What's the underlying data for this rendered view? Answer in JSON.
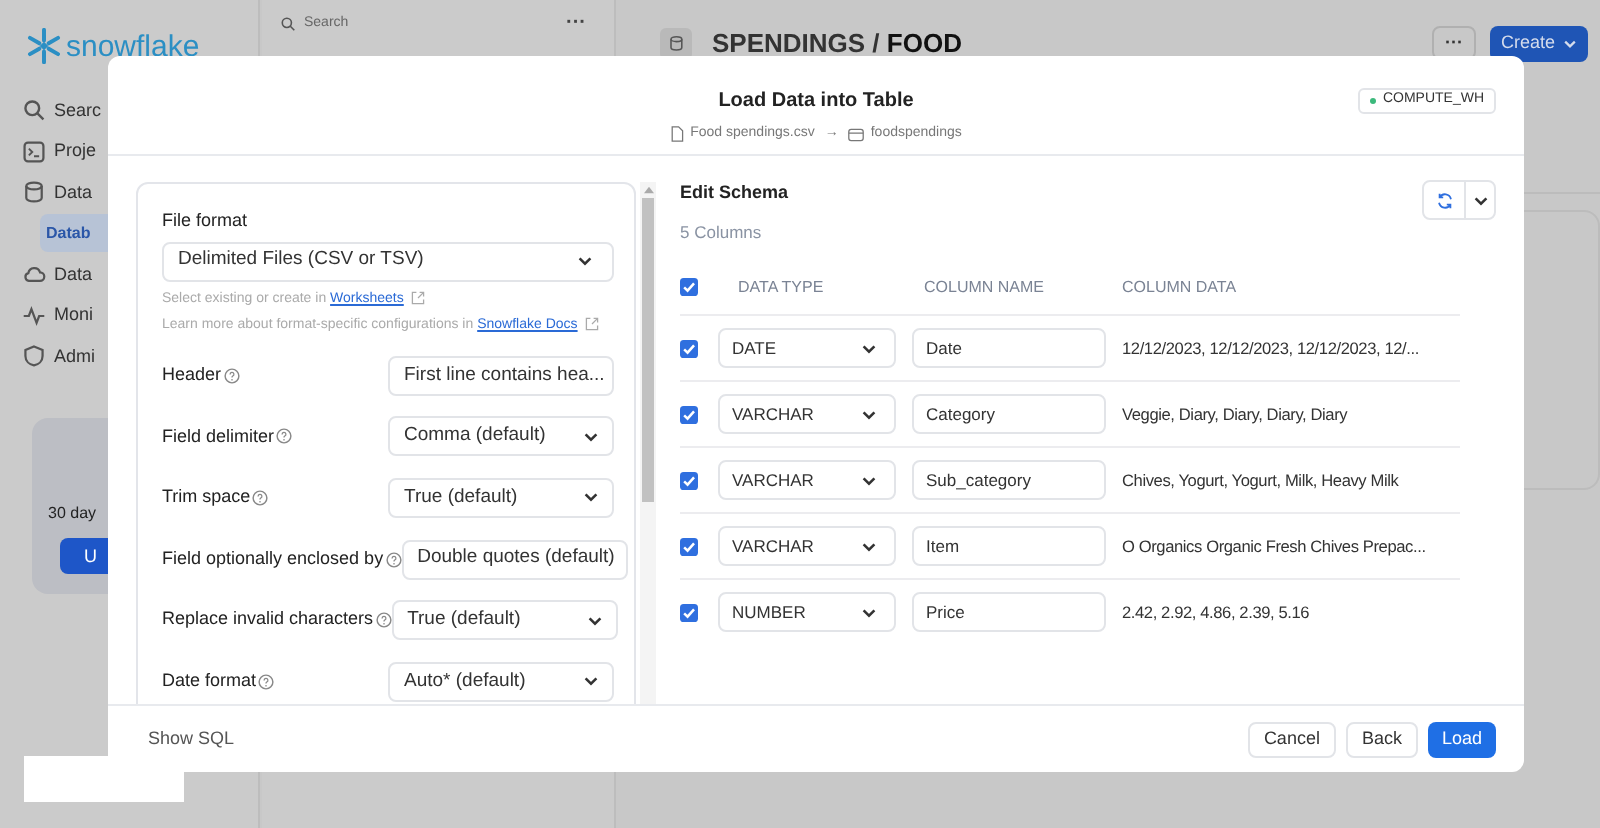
{
  "sidebar": {
    "logo": "snowflake",
    "items": [
      {
        "label": "Searc",
        "selected": false
      },
      {
        "label": "Proje",
        "selected": false
      },
      {
        "label": "Data",
        "selected": false
      },
      {
        "label": "Datab",
        "selected": true
      },
      {
        "label": "Data",
        "selected": false
      },
      {
        "label": "Moni",
        "selected": false
      },
      {
        "label": "Admi",
        "selected": false
      }
    ],
    "trial": {
      "text": "30 day",
      "button": "U"
    }
  },
  "browser": {
    "search_placeholder": "Search",
    "more": "···"
  },
  "page_header": {
    "title": "SPENDINGS / ",
    "title_bold": "FOOD",
    "more": "···",
    "create": "Create"
  },
  "dialog": {
    "title": "Load Data into Table",
    "source_file": "Food spendings.csv",
    "arrow": "→",
    "target_table": "foodspendings",
    "warehouse": "COMPUTE_WH",
    "file_format": {
      "label": "File format",
      "value": "Delimited Files (CSV or TSV)",
      "hint_text": "Select existing or create in ",
      "hint_link": "Worksheets",
      "docs_text": "Learn more about format-specific configurations in ",
      "docs_link": "Snowflake Docs"
    },
    "options": [
      {
        "label": "Header",
        "value": "First line contains hea..."
      },
      {
        "label": "Field delimiter",
        "value": "Comma (default)"
      },
      {
        "label": "Trim space",
        "value": "True (default)"
      },
      {
        "label": "Field optionally enclosed by",
        "value": "Double quotes (default)"
      },
      {
        "label": "Replace invalid characters",
        "value": "True (default)"
      },
      {
        "label": "Date format",
        "value": "Auto* (default)"
      }
    ],
    "schema": {
      "title": "Edit Schema",
      "count": "5 Columns",
      "all_checked": true,
      "columns": [
        "DATA TYPE",
        "COLUMN NAME",
        "COLUMN DATA"
      ],
      "rows": [
        {
          "checked": true,
          "type": "DATE",
          "name": "Date",
          "data": "12/12/2023, 12/12/2023, 12/12/2023, 12/..."
        },
        {
          "checked": true,
          "type": "VARCHAR",
          "name": "Category",
          "data": "Veggie, Diary, Diary, Diary, Diary"
        },
        {
          "checked": true,
          "type": "VARCHAR",
          "name": "Sub_category",
          "data": "Chives, Yogurt, Yogurt, Milk, Heavy Milk"
        },
        {
          "checked": true,
          "type": "VARCHAR",
          "name": "Item",
          "data": "O Organics Organic Fresh Chives Prepac..."
        },
        {
          "checked": true,
          "type": "NUMBER",
          "name": "Price",
          "data": "2.42, 2.92, 4.86, 2.39, 5.16"
        }
      ]
    },
    "show_sql": "Show SQL",
    "buttons": [
      "Cancel",
      "Back",
      "Load"
    ]
  }
}
